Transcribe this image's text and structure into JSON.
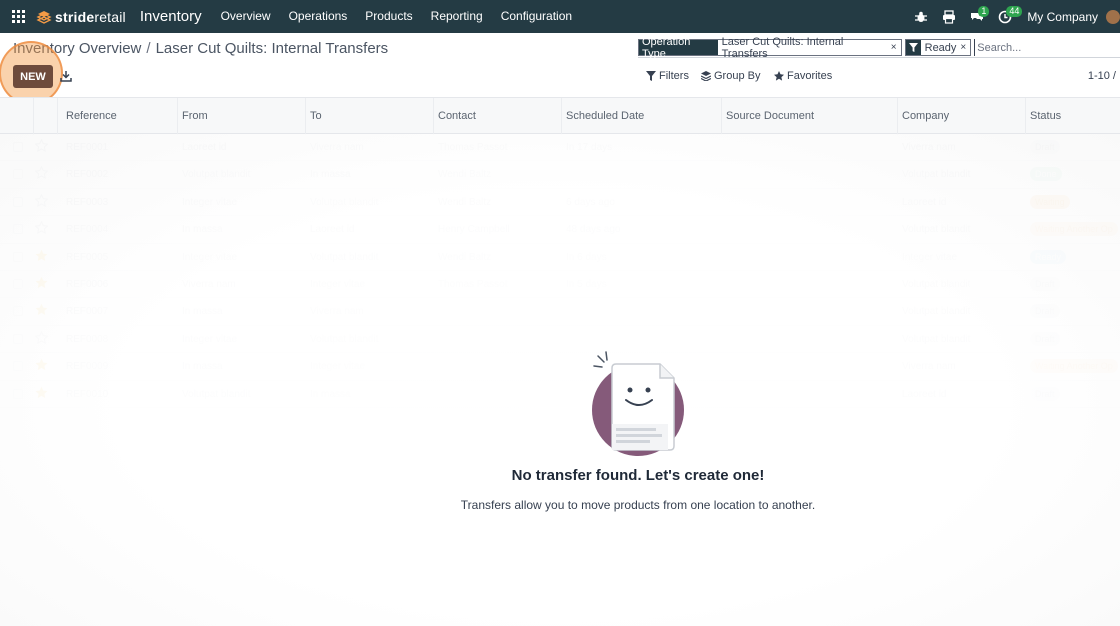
{
  "nav": {
    "brand_strong": "stride",
    "brand_rest": "retail",
    "app_name": "Inventory",
    "items": [
      "Overview",
      "Operations",
      "Products",
      "Reporting",
      "Configuration"
    ],
    "messages_badge": "1",
    "activities_badge": "44",
    "company": "My Company"
  },
  "breadcrumb": {
    "parent": "Inventory Overview",
    "separator": "/",
    "current": "Laser Cut Quilts: Internal Transfers"
  },
  "toolbar": {
    "new_label": "NEW"
  },
  "search": {
    "facets": [
      {
        "label": "Operation Type",
        "value": "Laser Cut Quilts: Internal Transfers"
      },
      {
        "label": "",
        "value": "Ready"
      }
    ],
    "placeholder": "Search...",
    "filters_label": "Filters",
    "group_by_label": "Group By",
    "favorites_label": "Favorites",
    "pager": "1-10 /"
  },
  "table": {
    "columns": [
      "Reference",
      "From",
      "To",
      "Contact",
      "Scheduled Date",
      "Source Document",
      "Company",
      "Status"
    ],
    "rows": [
      {
        "ref": "REF0001",
        "from": "Laoreet id",
        "to": "Viverra nam",
        "contact": "Thomas Passot",
        "date": "In 17 days",
        "company": "Viverra nam",
        "status": "Draft",
        "starred": false
      },
      {
        "ref": "REF0002",
        "from": "Volutpat blandit",
        "to": "In massa",
        "contact": "Wendi Baltz",
        "date": "",
        "company": "Volutpat blandit",
        "status": "Done",
        "starred": false
      },
      {
        "ref": "REF0003",
        "from": "Integer vitae",
        "to": "Volutpat blandit",
        "contact": "Wendi Baltz",
        "date": "6 days ago",
        "company": "Laoreet id",
        "status": "Waiting",
        "starred": false
      },
      {
        "ref": "REF0004",
        "from": "In massa",
        "to": "Laoreet id",
        "contact": "Henry Campbell",
        "date": "48 days ago",
        "company": "Volutpat blandit",
        "status": "Waiting Another Op",
        "starred": false
      },
      {
        "ref": "REF0005",
        "from": "Integer vitae",
        "to": "Volutpat blandit",
        "contact": "Wendi Baltz",
        "date": "In 6 days",
        "company": "Integer vitae",
        "status": "Ready",
        "starred": true
      },
      {
        "ref": "REF0006",
        "from": "Viverra nam",
        "to": "Integer vitae",
        "contact": "Thomas Passot",
        "date": "In 5 days",
        "company": "Volutpat blandit",
        "status": "Draft",
        "starred": true
      },
      {
        "ref": "REF0007",
        "from": "In massa",
        "to": "Viverra nam",
        "contact": "",
        "date": "",
        "company": "Volutpat blandit",
        "status": "Draft",
        "starred": true
      },
      {
        "ref": "REF0008",
        "from": "Integer vitae",
        "to": "Volutpat blandit",
        "contact": "",
        "date": "",
        "company": "Volutpat blandit",
        "status": "Draft",
        "starred": false
      },
      {
        "ref": "REF0009",
        "from": "In massa",
        "to": "Integer vitae",
        "contact": "",
        "date": "",
        "company": "Viverra nam",
        "status": "Waiting Another Op",
        "starred": true
      },
      {
        "ref": "REF0010",
        "from": "Volutpat blandit",
        "to": "In massa",
        "contact": "",
        "date": "",
        "company": "Laoreet id",
        "status": "Draft",
        "starred": true
      }
    ]
  },
  "empty_state": {
    "title": "No transfer found. Let's create one!",
    "subtitle": "Transfers allow you to move products from one location to another."
  },
  "colors": {
    "navbar": "#243b44",
    "primary_button": "#6e4b3c",
    "highlight_ring": "#f39b46",
    "badge": "#2ea44f"
  }
}
